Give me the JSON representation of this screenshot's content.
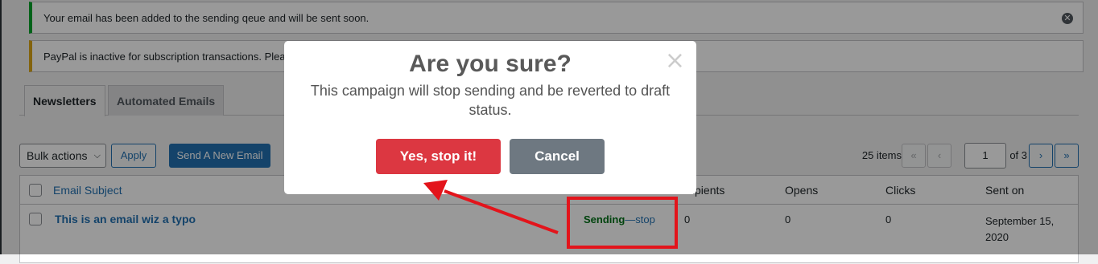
{
  "notices": {
    "success_text": "Your email has been added to the sending qeue and will be sent soon.",
    "warning_text": "PayPal is inactive for subscription transactions. Please"
  },
  "tabs": [
    {
      "label": "Newsletters",
      "active": true
    },
    {
      "label": "Automated Emails",
      "active": false
    }
  ],
  "toolbar": {
    "bulk_actions": "Bulk actions",
    "apply": "Apply",
    "send_new_email": "Send A New Email"
  },
  "pagination": {
    "items_count": "25 items",
    "first": "«",
    "prev": "‹",
    "current_page": "1",
    "of_pages": "of 3",
    "next": "›",
    "last": "»"
  },
  "table": {
    "columns": {
      "subject": "Email Subject",
      "recipients": "Recipients",
      "opens": "Opens",
      "clicks": "Clicks",
      "sent_on": "Sent on"
    },
    "rows": [
      {
        "subject": "This is an email wiz a typo",
        "status": "Sending",
        "status_sep": "—",
        "status_action": "stop",
        "recipients": "0",
        "opens": "0",
        "clicks": "0",
        "sent_on_line1": "September 15,",
        "sent_on_line2": "2020"
      }
    ]
  },
  "modal": {
    "title": "Are you sure?",
    "text": "This campaign will stop sending and be reverted to draft status.",
    "confirm": "Yes, stop it!",
    "cancel": "Cancel",
    "close": "×"
  },
  "colors": {
    "confirm_button": "#dc3741",
    "annotation": "#e3141b"
  }
}
